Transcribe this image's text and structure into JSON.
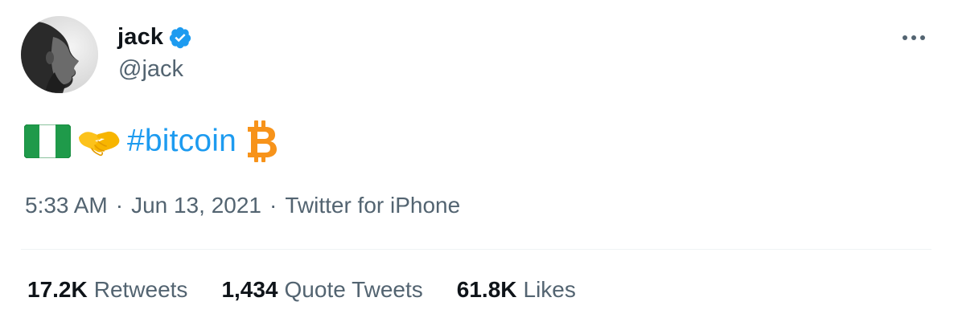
{
  "author": {
    "display_name": "jack",
    "handle": "@jack",
    "verified": true,
    "verified_icon": "verified-badge-icon",
    "avatar_icon": "profile-photo"
  },
  "menu": {
    "more_icon": "more-horizontal-icon"
  },
  "tweet": {
    "emojis": [
      "nigeria-flag-icon",
      "handshake-icon"
    ],
    "hashtag": "#bitcoin",
    "trailing_icon": "bitcoin-icon"
  },
  "meta": {
    "time": "5:33 AM",
    "separator": "·",
    "date": "Jun 13, 2021",
    "source": "Twitter for iPhone"
  },
  "stats": [
    {
      "value": "17.2K",
      "label": "Retweets"
    },
    {
      "value": "1,434",
      "label": "Quote Tweets"
    },
    {
      "value": "61.8K",
      "label": "Likes"
    }
  ],
  "colors": {
    "accent": "#1d9bf0",
    "text_primary": "#0f1419",
    "text_secondary": "#536471",
    "bitcoin": "#f7931a",
    "flag_green": "#1f9a4a",
    "divider": "#eff3f4"
  }
}
